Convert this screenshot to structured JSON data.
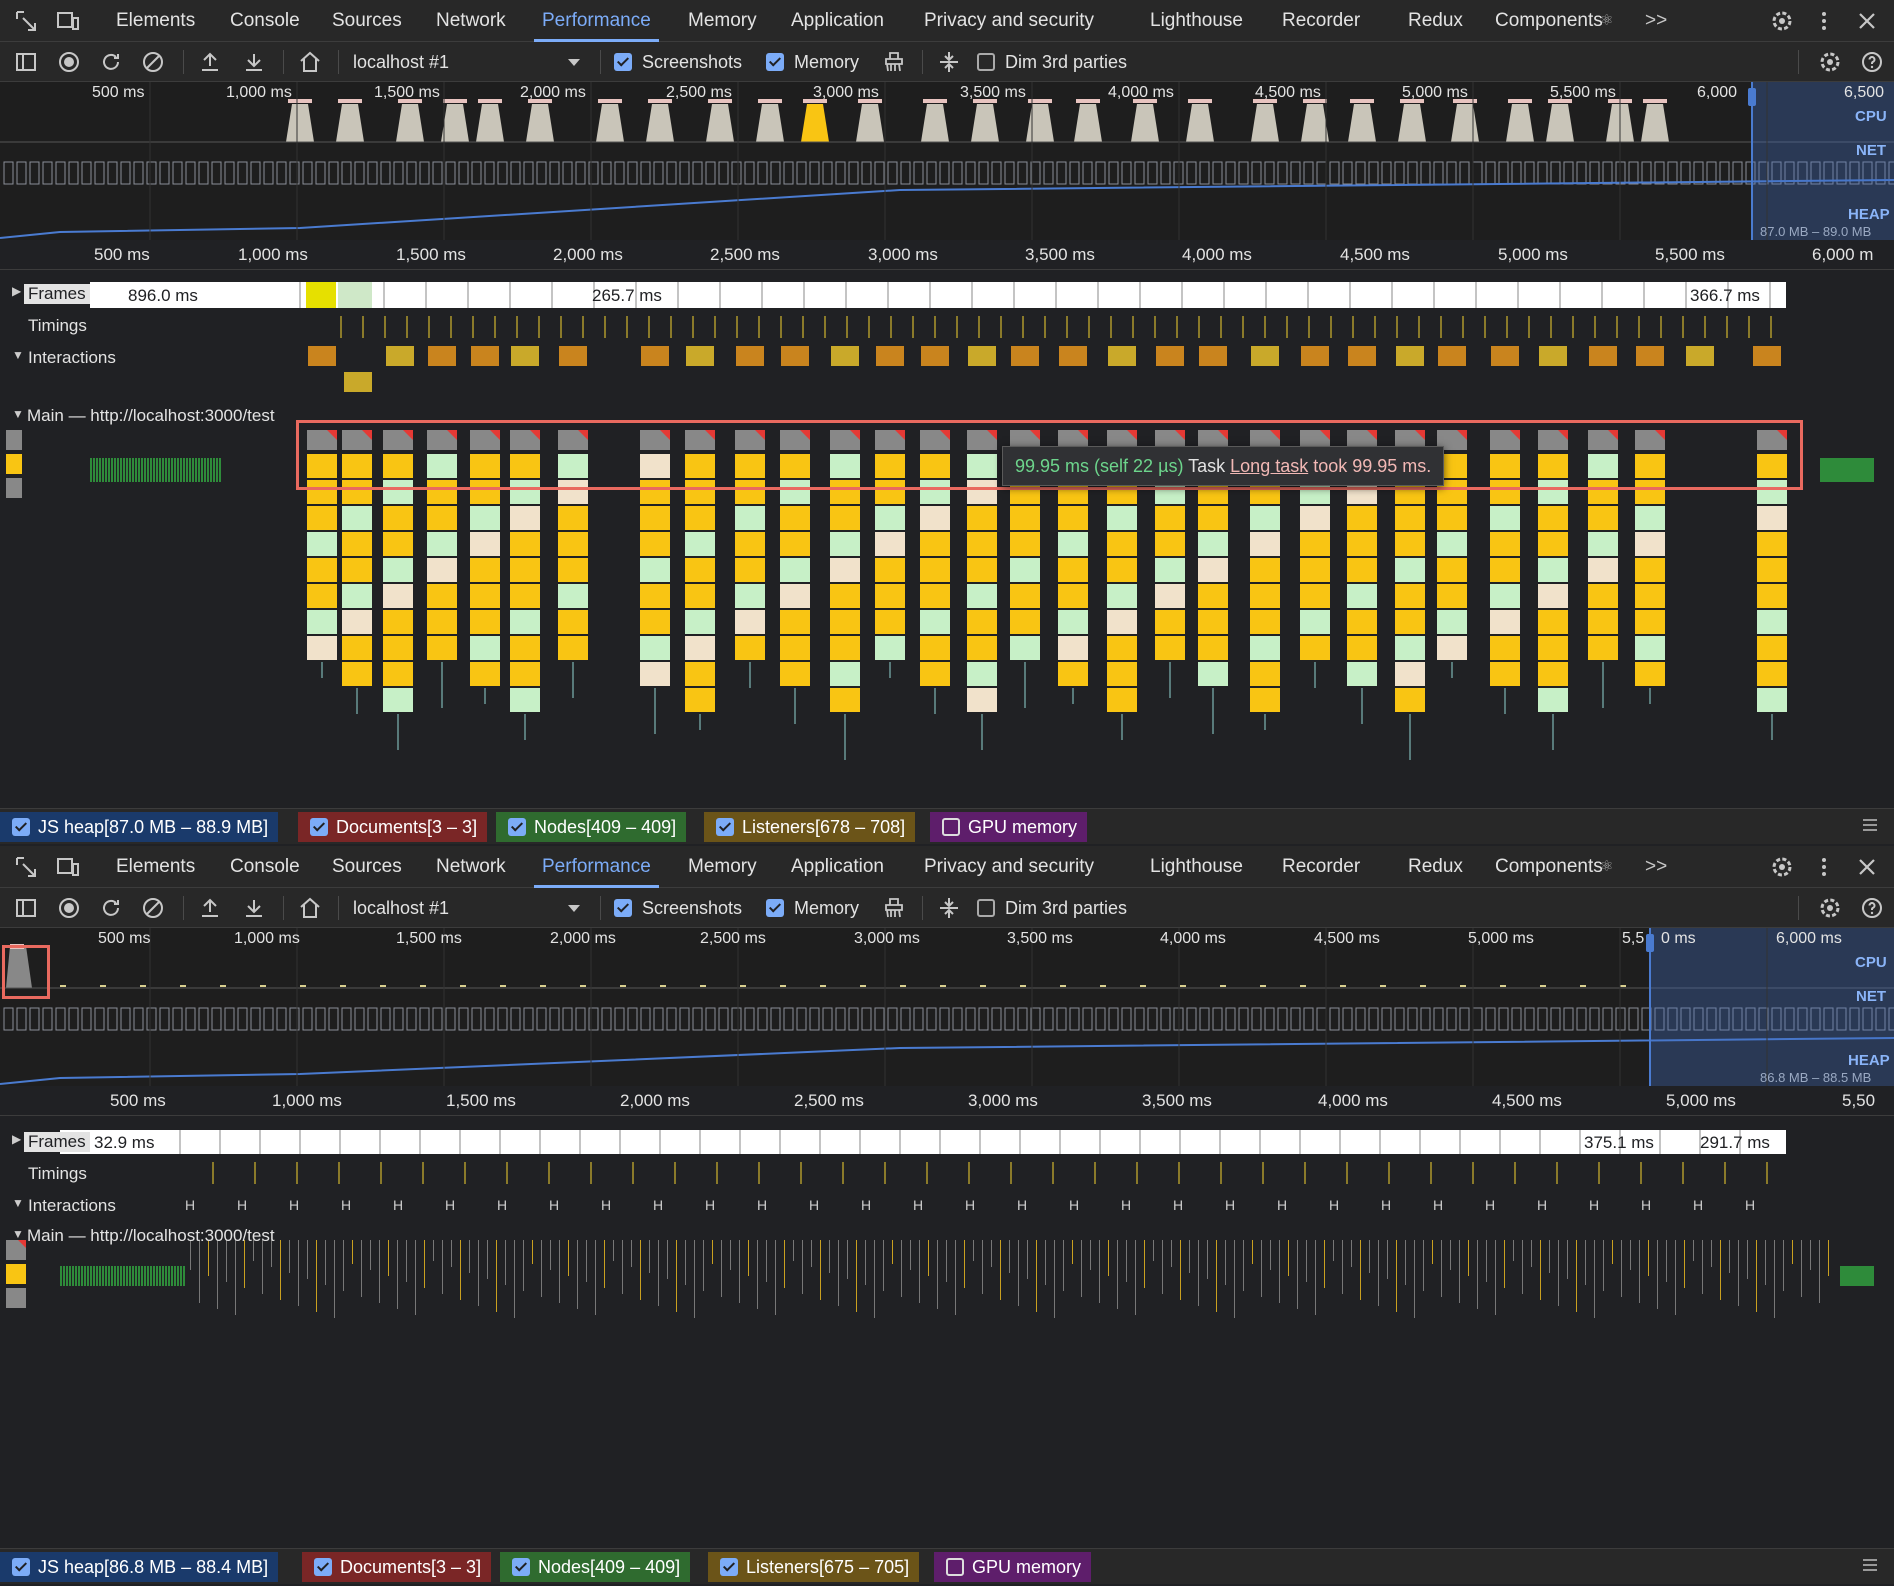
{
  "panels": [
    {
      "tabs": [
        "Elements",
        "Console",
        "Sources",
        "Network",
        "Performance",
        "Memory",
        "Application",
        "Privacy and security",
        "Lighthouse",
        "Recorder",
        "Redux",
        "Components"
      ],
      "components_glyph": "⚛",
      "more_tabs": ">>",
      "active_tab": "Performance",
      "target": "localhost #1",
      "screenshots_label": "Screenshots",
      "memory_label": "Memory",
      "dim_label": "Dim 3rd parties",
      "overview_ticks": [
        "500 ms",
        "1,000 ms",
        "1,500 ms",
        "2,000 ms",
        "2,500 ms",
        "3,000 ms",
        "3,500 ms",
        "4,000 ms",
        "4,500 ms",
        "5,000 ms",
        "5,500 ms",
        "6,000",
        "6,500"
      ],
      "cpu_label": "CPU",
      "net_label": "NET",
      "heap_label": "HEAP",
      "heap_range": "87.0 MB – 89.0 MB",
      "ruler_ticks": [
        "500 ms",
        "1,000 ms",
        "1,500 ms",
        "2,000 ms",
        "2,500 ms",
        "3,000 ms",
        "3,500 ms",
        "4,000 ms",
        "4,500 ms",
        "5,000 ms",
        "5,500 ms",
        "6,000 m"
      ],
      "frames_label": "Frames",
      "frame_times": [
        "896.0 ms",
        "265.7 ms",
        "366.7 ms"
      ],
      "timings_label": "Timings",
      "interactions_label": "Interactions",
      "main_label": "Main — http://localhost:3000/test",
      "tooltip": {
        "time": "99.95 ms (self 22 µs)",
        "name": "Task",
        "link": "Long task",
        "rest": "took 99.95 ms."
      },
      "legend": [
        {
          "label": "JS heap[87.0 MB – 88.9 MB]",
          "checked": true,
          "color": "#1a3a6b"
        },
        {
          "label": "Documents[3 – 3]",
          "checked": true,
          "color": "#7a2626"
        },
        {
          "label": "Nodes[409 – 409]",
          "checked": true,
          "color": "#2f6b2f"
        },
        {
          "label": "Listeners[678 – 708]",
          "checked": true,
          "color": "#6b5418"
        },
        {
          "label": "GPU memory",
          "checked": false,
          "color": "#5e1e6b"
        }
      ]
    },
    {
      "tabs": [
        "Elements",
        "Console",
        "Sources",
        "Network",
        "Performance",
        "Memory",
        "Application",
        "Privacy and security",
        "Lighthouse",
        "Recorder",
        "Redux",
        "Components"
      ],
      "components_glyph": "⚛",
      "more_tabs": ">>",
      "active_tab": "Performance",
      "target": "localhost #1",
      "screenshots_label": "Screenshots",
      "memory_label": "Memory",
      "dim_label": "Dim 3rd parties",
      "overview_ticks": [
        "500 ms",
        "1,000 ms",
        "1,500 ms",
        "2,000 ms",
        "2,500 ms",
        "3,000 ms",
        "3,500 ms",
        "4,000 ms",
        "4,500 ms",
        "5,000 ms",
        "5,5",
        "0 ms",
        "6,000 ms"
      ],
      "cpu_label": "CPU",
      "net_label": "NET",
      "heap_label": "HEAP",
      "heap_range": "86.8 MB – 88.5 MB",
      "ruler_ticks": [
        "500 ms",
        "1,000 ms",
        "1,500 ms",
        "2,000 ms",
        "2,500 ms",
        "3,000 ms",
        "3,500 ms",
        "4,000 ms",
        "4,500 ms",
        "5,000 ms",
        "5,50"
      ],
      "frames_label": "Frames",
      "frame_times": [
        "32.9 ms",
        "375.1 ms",
        "291.7 ms"
      ],
      "timings_label": "Timings",
      "interactions_label": "Interactions",
      "main_label": "Main — http://localhost:3000/test",
      "legend": [
        {
          "label": "JS heap[86.8 MB – 88.4 MB]",
          "checked": true,
          "color": "#1a3a6b"
        },
        {
          "label": "Documents[3 – 3]",
          "checked": true,
          "color": "#7a2626"
        },
        {
          "label": "Nodes[409 – 409]",
          "checked": true,
          "color": "#2f6b2f"
        },
        {
          "label": "Listeners[675 – 705]",
          "checked": true,
          "color": "#6b5418"
        },
        {
          "label": "GPU memory",
          "checked": false,
          "color": "#5e1e6b"
        }
      ]
    }
  ],
  "colors": {
    "accent": "#7cacf8",
    "task_yellow": "#f9c513",
    "task_green": "#c7f0c7",
    "task_beige": "#f1e2cb",
    "long_task_red": "#e53935",
    "highlight": "#e96a5f"
  }
}
